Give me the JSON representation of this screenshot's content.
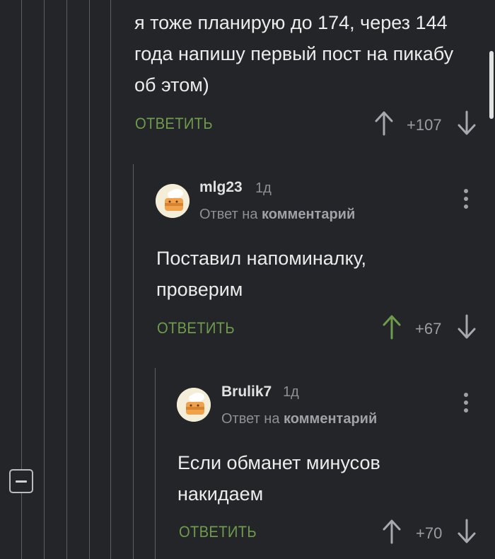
{
  "comments": [
    {
      "text": "я тоже планирую до 174, через 144 года напишу первый пост на пикабу об этом)",
      "reply_label": "ОТВЕТИТЬ",
      "score": "+107",
      "upvoted": false
    },
    {
      "username": "mlg23",
      "time": "1д",
      "reply_to_prefix": "Ответ на",
      "reply_to_link": "комментарий",
      "text": "Поставил напоминалку, проверим",
      "reply_label": "ОТВЕТИТЬ",
      "score": "+67",
      "upvoted": true
    },
    {
      "username": "Brulik7",
      "time": "1д",
      "reply_to_prefix": "Ответ на",
      "reply_to_link": "комментарий",
      "text": "Если обманет минусов накидаем",
      "reply_label": "ОТВЕТИТЬ",
      "score": "+70",
      "upvoted": false
    }
  ],
  "colors": {
    "background": "#232528",
    "accent_green": "#6e9b4c",
    "thread_line": "#5c5f64",
    "muted_text": "#8d9094"
  },
  "icons": {
    "collapse": "minus-square-icon",
    "upvote": "arrow-up-icon",
    "downvote": "arrow-down-icon",
    "menu": "vertical-dots-icon",
    "avatar": "chef-avatar-icon"
  }
}
